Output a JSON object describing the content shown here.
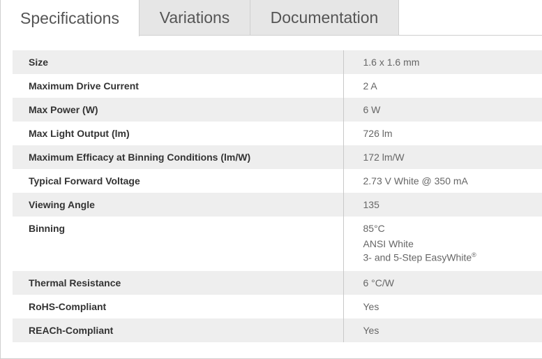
{
  "tabs": [
    {
      "label": "Specifications"
    },
    {
      "label": "Variations"
    },
    {
      "label": "Documentation"
    }
  ],
  "specs": {
    "rows": [
      {
        "label": "Size",
        "value": "1.6 x 1.6 mm"
      },
      {
        "label": "Maximum Drive Current",
        "value": "2 A"
      },
      {
        "label": "Max Power (W)",
        "value": "6 W"
      },
      {
        "label": "Max Light Output (lm)",
        "value": "726 lm"
      },
      {
        "label": "Maximum Efficacy at Binning Conditions (lm/W)",
        "value": "172 lm/W"
      },
      {
        "label": "Typical Forward Voltage",
        "value": "2.73 V White @ 350 mA"
      },
      {
        "label": "Viewing Angle",
        "value": "135"
      },
      {
        "label": "Binning",
        "values": [
          "85°C",
          "ANSI White",
          "3- and 5-Step EasyWhite"
        ],
        "registered_mark": "®"
      },
      {
        "label": "Thermal Resistance",
        "value": "6 °C/W"
      },
      {
        "label": "RoHS-Compliant",
        "value": "Yes"
      },
      {
        "label": "REACh-Compliant",
        "value": "Yes"
      }
    ]
  }
}
